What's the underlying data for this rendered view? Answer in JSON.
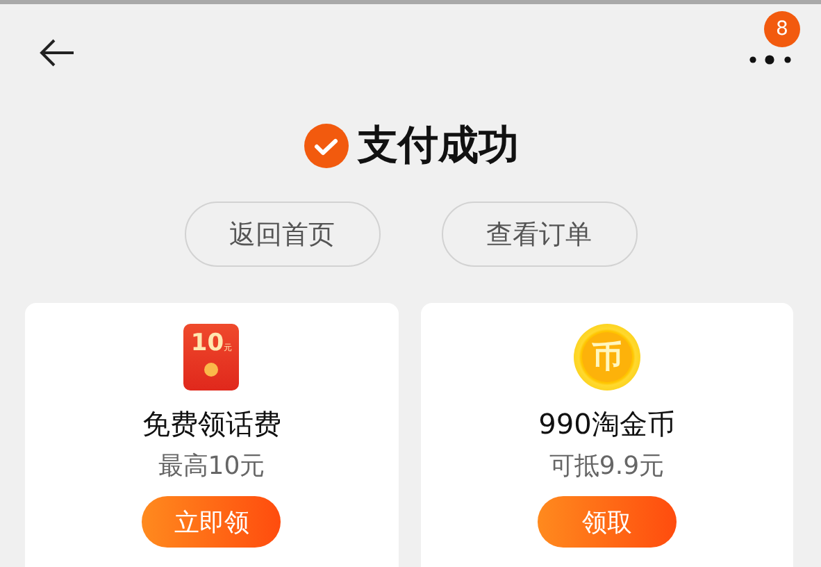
{
  "header": {
    "badge": "8"
  },
  "title": "支付成功",
  "actions": [
    "返回首页",
    "查看订单"
  ],
  "offers": [
    {
      "kind": "red-packet",
      "icon_text": "10",
      "icon_unit": "元",
      "title": "免费领话费",
      "subtitle": "最高10元",
      "button": "立即领"
    },
    {
      "kind": "coin",
      "icon_text": "币",
      "title": "990淘金币",
      "subtitle": "可抵9.9元",
      "button": "领取"
    }
  ]
}
